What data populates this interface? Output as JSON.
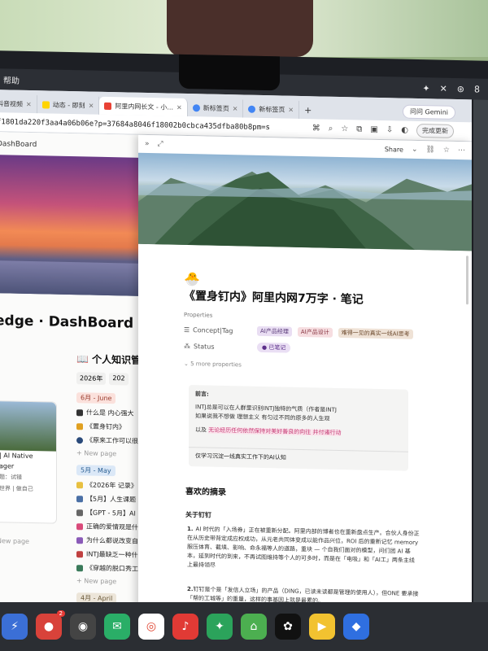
{
  "menubar": {
    "app_label": "帮助",
    "battery_label": "8"
  },
  "tabs": [
    {
      "label": "抖音视频",
      "color": "#111111"
    },
    {
      "label": "动态 - 即刻",
      "color": "#ffd400"
    },
    {
      "label": "阿里内网长文 - 小...",
      "color": "#e94235"
    },
    {
      "label": "新标签页",
      "color": "#4285f4"
    },
    {
      "label": "新标签页",
      "color": "#4285f4"
    }
  ],
  "browser": {
    "url": "f1801da220f3aa4a06b06e?p=37684a8046f18002b0cbca435dfba80b8pm=s",
    "gemini_label": "问问 Gemini",
    "update_label": "完成更新"
  },
  "left_pane": {
    "title": "DashBoard",
    "dashboard_heading": "edge · DashBoard",
    "card": {
      "line1": "| AI Native",
      "line2": "ager",
      "line3": "题：试错",
      "line4": "世界 | 做自己"
    },
    "new_page": "New page"
  },
  "kb": {
    "heading": "个人知识管",
    "tabs": [
      "2026年",
      "202"
    ],
    "june_label": "6月 - June",
    "june_items": [
      "什么是 内心强大",
      "《置身钉内》",
      "《原来工作可以很"
    ],
    "new_page": "New page",
    "may_label": "5月 - May",
    "may_items": [
      "《2026年 记录》",
      "【5月】人生课题 -",
      "【GPT - 5月】AI",
      "正确的爱情观是什么",
      "为什么都说改变自己",
      "INTJ最缺乏一种什么",
      "《穿越的脱口秀工作"
    ],
    "april_label": "4月 - April"
  },
  "article": {
    "share_label": "Share",
    "icon": "🐣",
    "title": "《置身钉内》阿里内网7万字 · 笔记",
    "properties_label": "Properties",
    "prop_concept_key": "Concept|Tag",
    "tags": [
      "AI产品经理",
      "AI产品设计",
      "难得一见的真实一线AI思考"
    ],
    "prop_status_key": "Status",
    "status_value": "已笔记",
    "more_props": "5 more properties",
    "callout": {
      "heading": "前言:",
      "line1": "INTJ总是可以在人群里识别INTJ独特的气质（作者是INTJ",
      "line2": "如果说我不想做 理想主义 有匀过不同的原多的人生观",
      "line3_prefix": "以及",
      "line3_highlight": "无论经历任何依然保持对美好善良的向往 并付诸行动"
    },
    "quote": "仅学习沉淀一线真实工作下的AI认知",
    "section_heading": "喜欢的摘录",
    "subheading": "关于钉钉",
    "para1": "AI 时代的「入场券」正在被重新分配。阿里内部的博者也在重新盘点生产。合伙人身份正在从历史带背定成应权成功，从元老共同体变成以能作品兴位，ROI 后的重新记忆 memory 服压体育、截填、影响、命永福等人的道路，重块 — 个自我们面对的模型，问们团 AI 基本，延到时代的到来，不再试图维持等个人的可多时，而是在「电吸」和「AI工」两条主线上最持领尽",
    "para2": "钉钉是个是「发信人立场」的产品（DING，已读未读都是管理的使用人），但ONE 要承接「帮的工城等」的重量，这样的事基因上就是最累的。"
  },
  "dock": [
    {
      "name": "launcher",
      "color": "#3b6fd6",
      "glyph": "⚡"
    },
    {
      "name": "chrome-red",
      "color": "#d8423a",
      "glyph": "●",
      "badge": "2"
    },
    {
      "name": "app-grey",
      "color": "#444444",
      "glyph": "◉"
    },
    {
      "name": "wechat",
      "color": "#2aae67",
      "glyph": "✉"
    },
    {
      "name": "chrome",
      "color": "#ffffff",
      "glyph": "◎"
    },
    {
      "name": "netease-music",
      "color": "#e13a35",
      "glyph": "♪"
    },
    {
      "name": "app-green",
      "color": "#2ba35b",
      "glyph": "✦"
    },
    {
      "name": "app-green2",
      "color": "#4caf50",
      "glyph": "⌂"
    },
    {
      "name": "chatgpt",
      "color": "#111111",
      "glyph": "✿"
    },
    {
      "name": "video",
      "color": "#f2c230",
      "glyph": "▶"
    },
    {
      "name": "app-blue",
      "color": "#2f6fe0",
      "glyph": "◆"
    }
  ]
}
